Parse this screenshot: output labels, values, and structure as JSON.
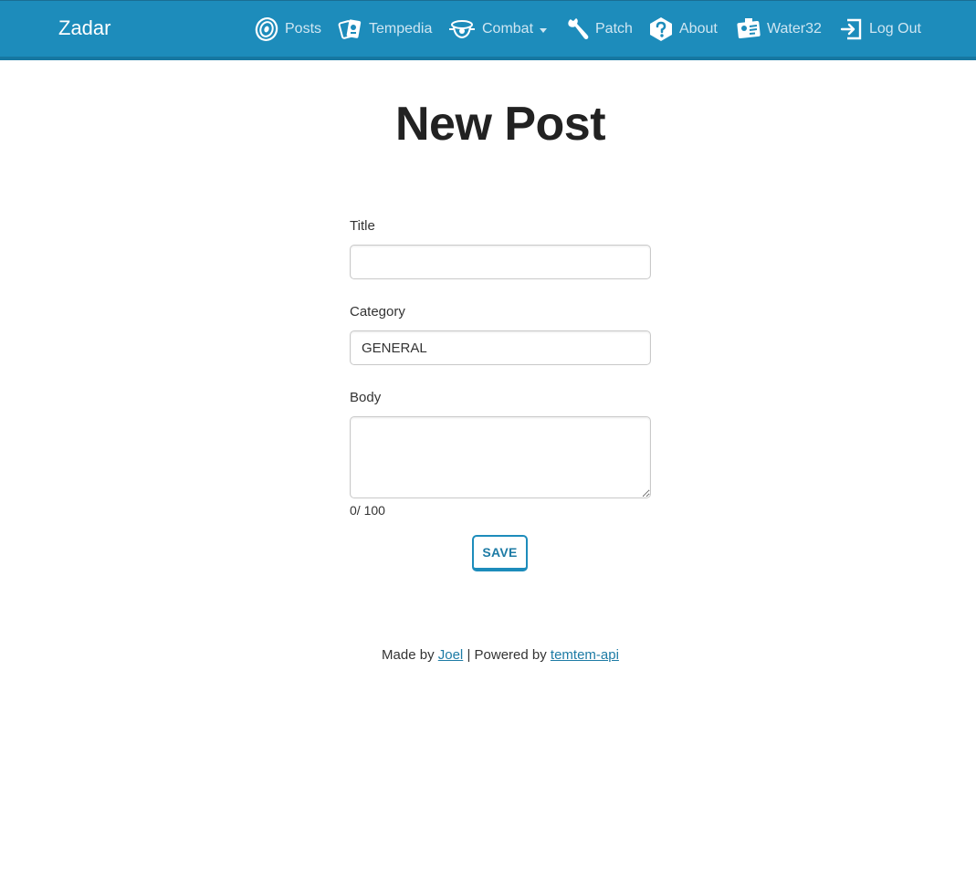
{
  "navbar": {
    "brand": "Zadar",
    "items": [
      {
        "label": "Posts",
        "icon": "target-icon"
      },
      {
        "label": "Tempedia",
        "icon": "cards-icon"
      },
      {
        "label": "Combat",
        "icon": "battle-icon",
        "dropdown": true
      },
      {
        "label": "Patch",
        "icon": "wrench-icon"
      },
      {
        "label": "About",
        "icon": "question-icon"
      },
      {
        "label": "Water32",
        "icon": "id-card-icon"
      },
      {
        "label": "Log Out",
        "icon": "logout-icon"
      }
    ],
    "colors": {
      "background": "#1d8cbb",
      "text": "#cfe6f2",
      "brand": "#ffffff"
    }
  },
  "page": {
    "title": "New Post"
  },
  "form": {
    "title_label": "Title",
    "title_value": "",
    "category_label": "Category",
    "category_value": "GENERAL",
    "body_label": "Body",
    "body_value": "",
    "counter": "0/ 100",
    "save_label": "SAVE"
  },
  "footer": {
    "made_by": "Made by ",
    "author": "Joel",
    "separator": " | Powered by ",
    "powered_by": "temtem-api"
  },
  "colors": {
    "accent": "#1d8cbb",
    "link": "#1d7ba5"
  }
}
